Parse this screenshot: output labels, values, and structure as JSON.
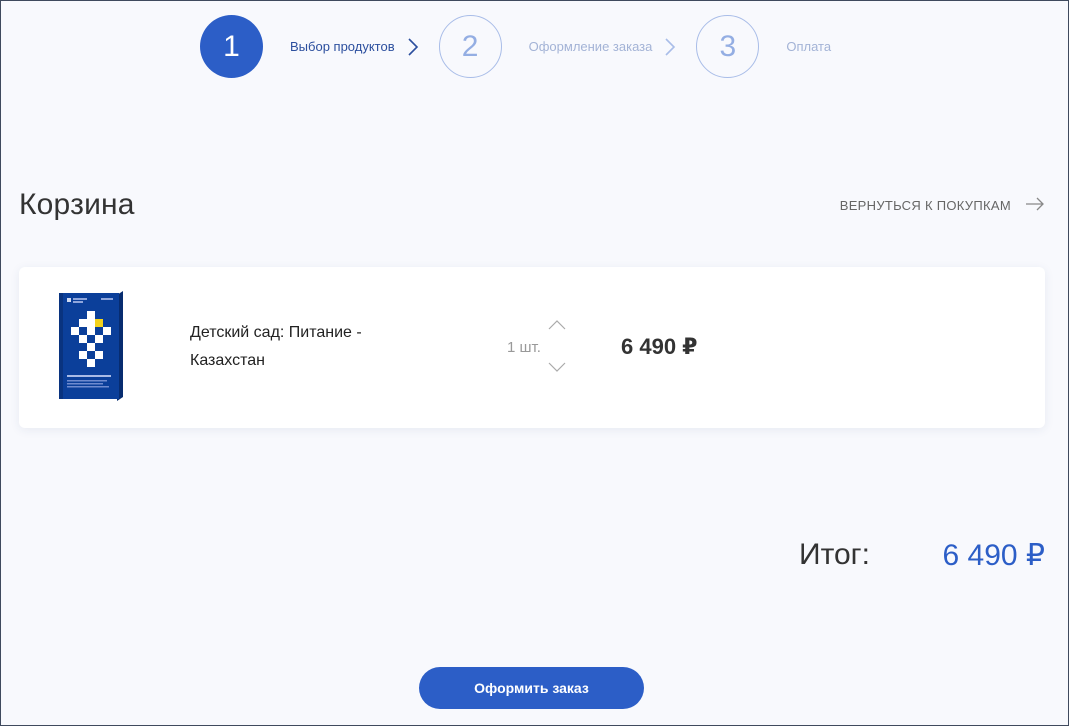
{
  "steps": [
    {
      "number": "1",
      "label": "Выбор продуктов",
      "state": "active"
    },
    {
      "number": "2",
      "label": "Оформление заказа",
      "state": "inactive"
    },
    {
      "number": "3",
      "label": "Оплата",
      "state": "inactive"
    }
  ],
  "cart": {
    "title": "Корзина",
    "back_link": "ВЕРНУТЬСЯ К ПОКУПКАМ",
    "items": [
      {
        "name": "Детский сад: Питание - Казахстан",
        "quantity": "1 шт.",
        "price": "6 490 ₽"
      }
    ]
  },
  "total": {
    "label": "Итог:",
    "value": "6 490 ₽"
  },
  "checkout_label": "Оформить заказ",
  "colors": {
    "accent": "#2c5ec7",
    "background": "#f8f9fd",
    "product_cover": "#0b3f9a",
    "product_highlight": "#f3d21b"
  },
  "icons": {
    "step_separator": "chevron-right-icon",
    "back_link": "arrow-right-icon",
    "qty_up": "chevron-up-icon",
    "qty_down": "chevron-down-icon"
  }
}
